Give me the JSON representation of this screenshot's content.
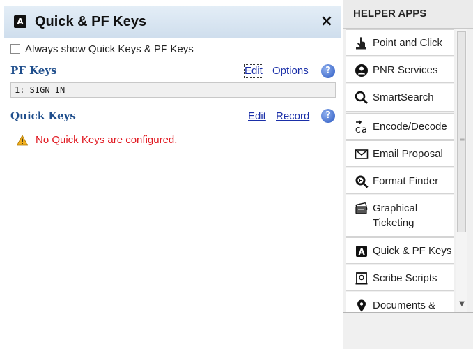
{
  "panel": {
    "title": "Quick & PF Keys",
    "icon_letter": "A",
    "close_label": "×",
    "always_show_label": "Always show Quick Keys & PF Keys",
    "always_show_checked": false
  },
  "pf_keys": {
    "title": "PF Keys",
    "edit_label": "Edit",
    "options_label": "Options",
    "help_label": "?",
    "items": [
      "1: SIGN IN"
    ]
  },
  "quick_keys": {
    "title": "Quick Keys",
    "edit_label": "Edit",
    "record_label": "Record",
    "help_label": "?",
    "warning": "No Quick Keys are configured."
  },
  "helper_apps": {
    "title": "HELPER APPS",
    "items": [
      {
        "label": "Point and Click",
        "icon": "touch-pointer-icon"
      },
      {
        "label": "PNR Services",
        "icon": "person-circle-icon"
      },
      {
        "label": "SmartSearch",
        "icon": "magnifier-icon"
      },
      {
        "label": "Encode/Decode",
        "icon": "encode-decode-icon"
      },
      {
        "label": "Email Proposal",
        "icon": "envelope-icon"
      },
      {
        "label": "Format Finder",
        "icon": "format-finder-icon"
      },
      {
        "label": "Graphical Ticketing",
        "icon": "ticket-icon"
      },
      {
        "label": "Quick & PF Keys",
        "icon": "quick-keys-a-icon"
      },
      {
        "label": "Scribe Scripts",
        "icon": "scroll-icon"
      },
      {
        "label": "Documents &",
        "icon": "location-pin-icon"
      }
    ]
  },
  "colors": {
    "header_blue": "#cfdeed",
    "link": "#1a2fa8",
    "section_title": "#1f4e8c",
    "warning_text": "#e0171f",
    "warning_icon": "#f2b01e"
  }
}
